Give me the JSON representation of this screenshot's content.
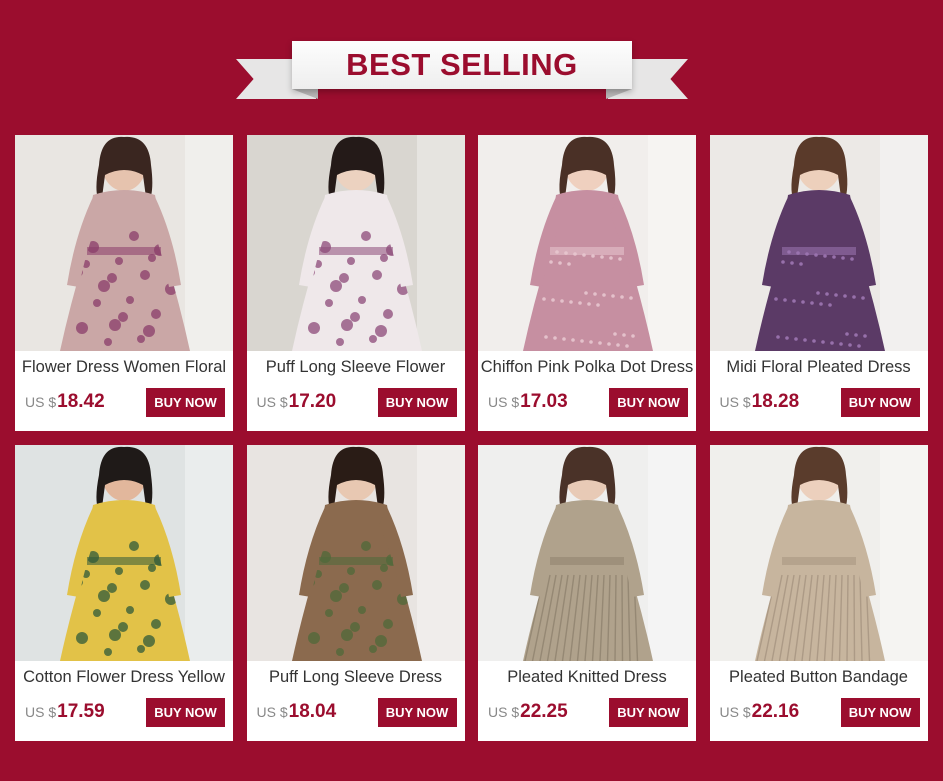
{
  "banner": {
    "title": "BEST SELLING"
  },
  "colors": {
    "background": "#9b0d2e",
    "accent": "#9b0d2e",
    "card": "#ffffff"
  },
  "products": [
    {
      "name": "Flower Dress Women Floral",
      "currency": "US $",
      "price": "18.42",
      "button": "BUY NOW",
      "icon": "floral-dress-photo",
      "bg": "#e9e6e2",
      "dress": "#caa7a6",
      "accent": "#8a3c6a",
      "hair": "#3a2620",
      "skin": "#e6c3ae",
      "pattern": "floral"
    },
    {
      "name": "Puff Long Sleeve Flower",
      "currency": "US $",
      "price": "17.20",
      "button": "BUY NOW",
      "icon": "white-floral-dress-photo",
      "bg": "#d9d6d0",
      "dress": "#efe8ea",
      "accent": "#8c4a78",
      "hair": "#241a18",
      "skin": "#ecd2c0",
      "pattern": "floral"
    },
    {
      "name": "Chiffon Pink Polka Dot Dress",
      "currency": "US $",
      "price": "17.03",
      "button": "BUY NOW",
      "icon": "pink-dress-photo",
      "bg": "#f1eeec",
      "dress": "#c68fa1",
      "accent": "#e7c6cf",
      "hair": "#4a3026",
      "skin": "#efd0bf",
      "pattern": "dots"
    },
    {
      "name": "Midi Floral Pleated Dress",
      "currency": "US $",
      "price": "18.28",
      "button": "BUY NOW",
      "icon": "purple-dress-photo",
      "bg": "#ece9e6",
      "dress": "#5b3a66",
      "accent": "#9d77b2",
      "hair": "#5a3a2a",
      "skin": "#edd0bc",
      "pattern": "dots"
    },
    {
      "name": "Cotton Flower Dress Yellow",
      "currency": "US $",
      "price": "17.59",
      "button": "BUY NOW",
      "icon": "yellow-dress-photo",
      "bg": "#dfe3e3",
      "dress": "#e2c248",
      "accent": "#2f5a3a",
      "hair": "#1f1a18",
      "skin": "#e2b79c",
      "pattern": "floral"
    },
    {
      "name": "Puff Long Sleeve Dress",
      "currency": "US $",
      "price": "18.04",
      "button": "BUY NOW",
      "icon": "brown-floral-dress-photo",
      "bg": "#e8e4e1",
      "dress": "#8b6a4e",
      "accent": "#4f6a3a",
      "hair": "#2a1c16",
      "skin": "#e8c8b2",
      "pattern": "floral"
    },
    {
      "name": "Pleated Knitted Dress",
      "currency": "US $",
      "price": "22.25",
      "button": "BUY NOW",
      "icon": "knit-dress-photo",
      "bg": "#efefee",
      "dress": "#b0a28c",
      "accent": "#8f826e",
      "hair": "#4a3228",
      "skin": "#e8cab6",
      "pattern": "pleat"
    },
    {
      "name": "Pleated Button Bandage",
      "currency": "US $",
      "price": "22.16",
      "button": "BUY NOW",
      "icon": "button-dress-photo",
      "bg": "#f0efec",
      "dress": "#c7b59e",
      "accent": "#a69480",
      "hair": "#5a3c2c",
      "skin": "#ecd0bd",
      "pattern": "pleat"
    }
  ]
}
